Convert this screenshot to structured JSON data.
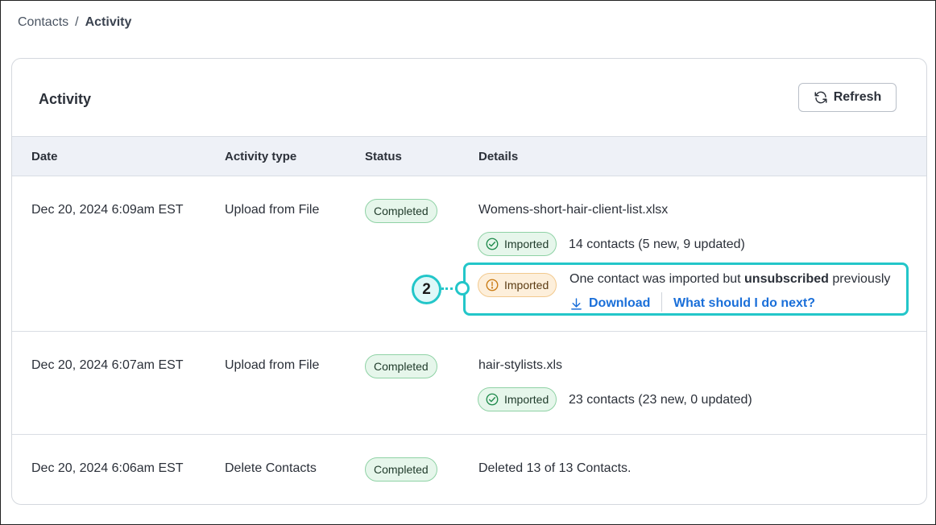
{
  "breadcrumb": {
    "parent": "Contacts",
    "separator": "/",
    "current": "Activity"
  },
  "card": {
    "title": "Activity",
    "refresh_label": "Refresh",
    "refresh_icon": "refresh-icon"
  },
  "table": {
    "headers": [
      "Date",
      "Activity type",
      "Status",
      "Details"
    ],
    "rows": [
      {
        "date": "Dec 20, 2024 6:09am EST",
        "type": "Upload from File",
        "status": "Completed",
        "file": "Womens-short-hair-client-list.xlsx",
        "imported_badge": "Imported",
        "imported_text": "14 contacts (5 new, 9 updated)",
        "warn_badge": "Imported",
        "warn_text_before": "One contact was imported but",
        "warn_text_bold": "unsubscribed",
        "warn_text_after": "previously",
        "download_label": "Download",
        "next_label": "What should I do next?"
      },
      {
        "date": "Dec 20, 2024 6:07am EST",
        "type": "Upload from File",
        "status": "Completed",
        "file": "hair-stylists.xls",
        "imported_badge": "Imported",
        "imported_text": "23 contacts (23 new, 0 updated)"
      },
      {
        "date": "Dec 20, 2024 6:06am EST",
        "type": "Delete Contacts",
        "status": "Completed",
        "details": "Deleted 13 of 13 Contacts."
      }
    ]
  },
  "callout": {
    "number": "2",
    "color": "#23c6c9"
  },
  "colors": {
    "success_bg": "#e6f6eb",
    "success_border": "#8fd2a5",
    "warn_bg": "#fdefdb",
    "warn_border": "#f2c98e",
    "link": "#1a6fd9",
    "header_bg": "#eef1f7"
  }
}
